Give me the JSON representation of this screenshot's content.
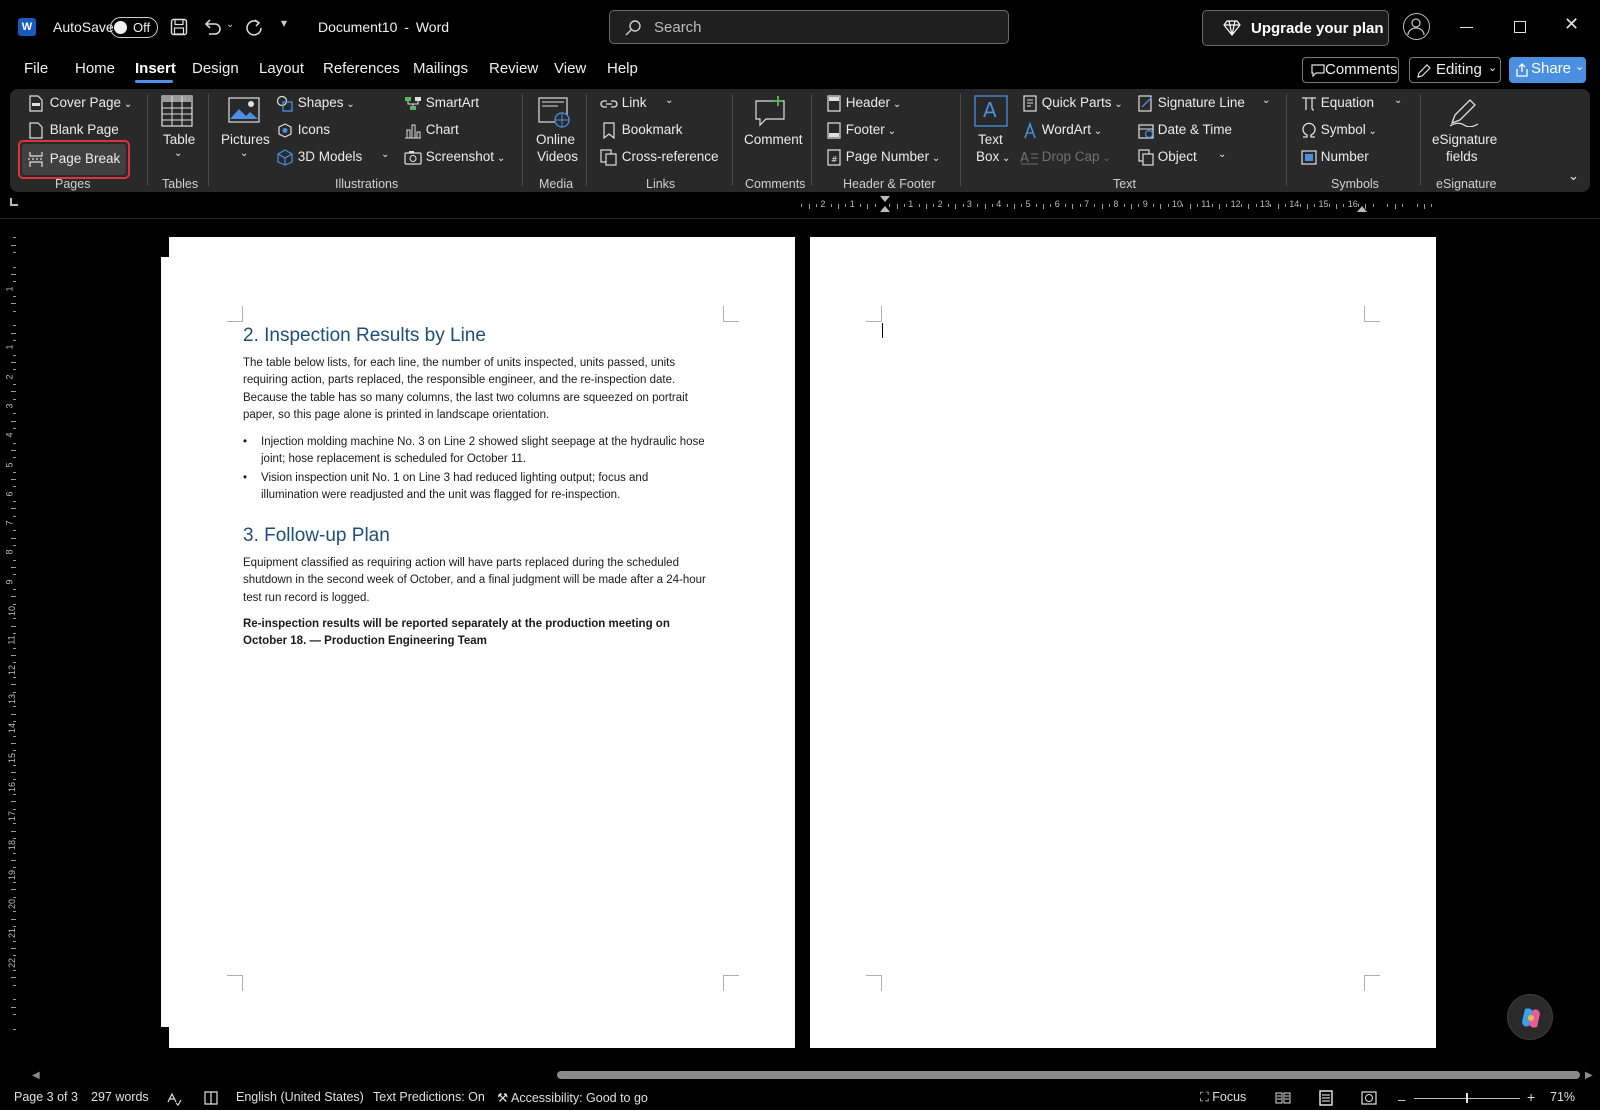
{
  "app": {
    "autosave_label": "AutoSave",
    "autosave_state": "Off",
    "doc_title": "Document10",
    "title_sep": "-",
    "app_name": "Word",
    "search_placeholder": "Search",
    "upgrade_label": "Upgrade your plan"
  },
  "menu": {
    "tabs": [
      "File",
      "Home",
      "Insert",
      "Design",
      "Layout",
      "References",
      "Mailings",
      "Review",
      "View",
      "Help"
    ],
    "active_tab": "Insert",
    "comments_label": "Comments",
    "editing_label": "Editing",
    "share_label": "Share"
  },
  "ribbon": {
    "pages": {
      "cover_page": "Cover Page",
      "blank_page": "Blank Page",
      "page_break": "Page Break",
      "group": "Pages"
    },
    "tables": {
      "table": "Table",
      "group": "Tables"
    },
    "illustrations": {
      "pictures": "Pictures",
      "shapes": "Shapes",
      "icons": "Icons",
      "models": "3D Models",
      "smartart": "SmartArt",
      "chart": "Chart",
      "screenshot": "Screenshot",
      "group": "Illustrations"
    },
    "media": {
      "online_videos_1": "Online",
      "online_videos_2": "Videos",
      "group": "Media"
    },
    "links": {
      "link": "Link",
      "bookmark": "Bookmark",
      "cross_reference": "Cross-reference",
      "group": "Links"
    },
    "comments": {
      "comment": "Comment",
      "group": "Comments"
    },
    "header_footer": {
      "header": "Header",
      "footer": "Footer",
      "page_number": "Page Number",
      "group": "Header & Footer"
    },
    "text": {
      "text_box_1": "Text",
      "text_box_2": "Box",
      "quick_parts": "Quick Parts",
      "wordart": "WordArt",
      "drop_cap": "Drop Cap",
      "signature_line": "Signature Line",
      "date_time": "Date & Time",
      "object": "Object",
      "group": "Text"
    },
    "symbols": {
      "equation": "Equation",
      "symbol": "Symbol",
      "number": "Number",
      "group": "Symbols"
    },
    "esignature": {
      "fields_1": "eSignature",
      "fields_2": "fields",
      "group": "eSignature"
    }
  },
  "document": {
    "section2_heading": "2. Inspection Results by Line",
    "section2_para_lines": [
      "The table below lists, for each line, the number of units inspected, units passed, units",
      "requiring action, parts replaced, the responsible engineer, and the re-inspection date.",
      "Because the table has so many columns, the last two columns are squeezed on portrait",
      "paper, so this page alone is printed in landscape orientation."
    ],
    "bullets": [
      [
        "Injection molding machine No. 3 on Line 2 showed slight seepage at the hydraulic hose",
        "joint; hose replacement is scheduled for October 11."
      ],
      [
        "Vision inspection unit No. 1 on Line 3 had reduced lighting output; focus and",
        "illumination were readjusted and the unit was flagged for re-inspection."
      ]
    ],
    "section3_heading": "3. Follow-up Plan",
    "section3_para_lines": [
      "Equipment classified as requiring action will have parts replaced during the scheduled",
      "shutdown in the second week of October, and a final judgment will be made after a 24-hour",
      "test run record is logged."
    ],
    "closing_lines": [
      "Re-inspection results will be reported separately at the production meeting on",
      "October 18. — Production Engineering Team"
    ]
  },
  "ruler": {
    "h_marks": [
      "2",
      "1",
      "1",
      "2",
      "3",
      "4",
      "5",
      "6",
      "7",
      "8",
      "9",
      "10",
      "11",
      "12",
      "13",
      "14",
      "15",
      "16"
    ],
    "v_marks": [
      "1",
      "1",
      "2",
      "3",
      "4",
      "5",
      "6",
      "7",
      "8",
      "9",
      "10",
      "11",
      "12",
      "13",
      "14",
      "15",
      "16",
      "17",
      "18",
      "19",
      "20",
      "21",
      "22"
    ]
  },
  "status": {
    "page": "Page 3 of 3",
    "words": "297 words",
    "language": "English (United States)",
    "predictions": "Text Predictions: On",
    "accessibility": "Accessibility: Good to go",
    "focus": "Focus",
    "zoom": "71%"
  },
  "colors": {
    "accent": "#4a8fe0",
    "heading": "#1f4e79",
    "highlight_box": "#e0323c",
    "ribbon_bg": "#292929"
  }
}
